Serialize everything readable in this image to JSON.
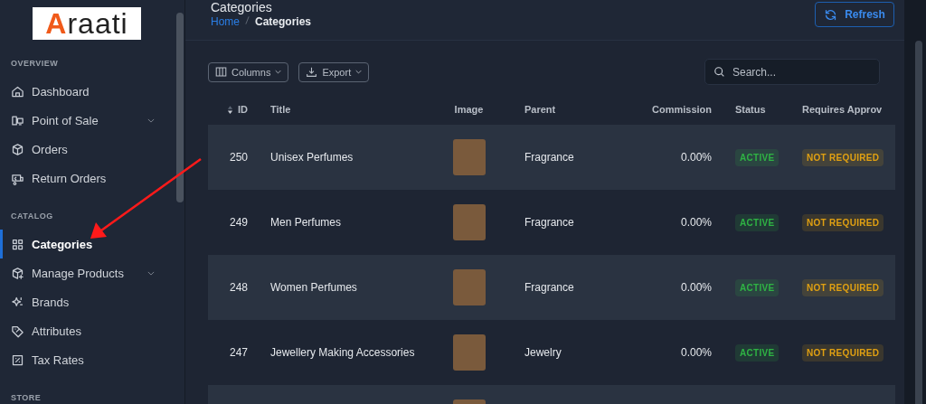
{
  "logo": {
    "text": "Araati"
  },
  "sidebar": {
    "sections": [
      {
        "title": "OVERVIEW",
        "items": [
          {
            "label": "Dashboard",
            "selected": false,
            "submenu": false
          },
          {
            "label": "Point of Sale",
            "selected": false,
            "submenu": true
          },
          {
            "label": "Orders",
            "selected": false,
            "submenu": false
          },
          {
            "label": "Return Orders",
            "selected": false,
            "submenu": false
          }
        ]
      },
      {
        "title": "CATALOG",
        "items": [
          {
            "label": "Categories",
            "selected": true,
            "submenu": false
          },
          {
            "label": "Manage Products",
            "selected": false,
            "submenu": true
          },
          {
            "label": "Brands",
            "selected": false,
            "submenu": false
          },
          {
            "label": "Attributes",
            "selected": false,
            "submenu": false
          },
          {
            "label": "Tax Rates",
            "selected": false,
            "submenu": false
          }
        ]
      },
      {
        "title": "STORE"
      }
    ]
  },
  "page": {
    "title": "Categories",
    "breadcrumb": [
      {
        "label": "Home",
        "link": true
      },
      {
        "label": "Categories",
        "link": false
      }
    ],
    "refresh_button": "Refresh"
  },
  "toolbar": {
    "columns_button": "Columns",
    "export_button": "Export",
    "search": {
      "placeholder": "Search..."
    }
  },
  "table": {
    "columns": [
      "ID",
      "Title",
      "Image",
      "Parent",
      "Commission",
      "Status",
      "Requires Approv"
    ],
    "rows": [
      {
        "id": "250",
        "title": "Unisex Perfumes",
        "parent": "Fragrance",
        "commission": "0.00%",
        "status": {
          "text": "ACTIVE",
          "color": "#2fb344"
        },
        "approval": {
          "text": "NOT REQUIRED",
          "color": "#e0a012"
        }
      },
      {
        "id": "249",
        "title": "Men Perfumes",
        "parent": "Fragrance",
        "commission": "0.00%",
        "status": {
          "text": "ACTIVE",
          "color": "#2fb344"
        },
        "approval": {
          "text": "NOT REQUIRED",
          "color": "#e0a012"
        }
      },
      {
        "id": "248",
        "title": "Women Perfumes",
        "parent": "Fragrance",
        "commission": "0.00%",
        "status": {
          "text": "ACTIVE",
          "color": "#2fb344"
        },
        "approval": {
          "text": "NOT REQUIRED",
          "color": "#e0a012"
        }
      },
      {
        "id": "247",
        "title": "Jewellery Making Accessories",
        "parent": "Jewelry",
        "commission": "0.00%",
        "status": {
          "text": "ACTIVE",
          "color": "#2fb344"
        },
        "approval": {
          "text": "NOT REQUIRED",
          "color": "#e0a012"
        }
      }
    ]
  }
}
